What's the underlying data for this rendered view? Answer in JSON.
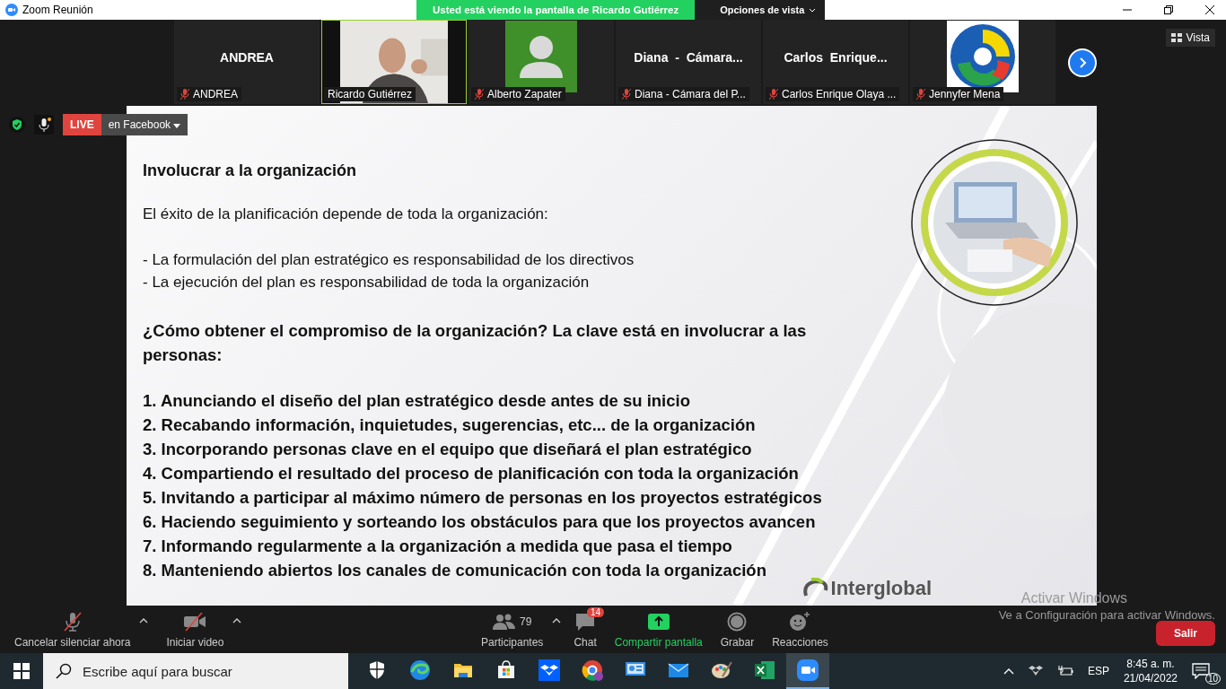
{
  "window": {
    "title": "Zoom Reunión"
  },
  "share_banner": {
    "text": "Usted está viendo la pantalla de Ricardo Gutiérrez",
    "view_options": "Opciones de vista"
  },
  "view_button": "Vista",
  "participants": [
    {
      "kind": "name",
      "display": "ANDREA",
      "name": "ANDREA",
      "muted": true,
      "speaking": false
    },
    {
      "kind": "video",
      "name": "Ricardo Gutiérrez",
      "muted": false,
      "speaking": true
    },
    {
      "kind": "avatar",
      "name": "Alberto Zapater",
      "muted": true,
      "speaking": false
    },
    {
      "kind": "name",
      "display": "Diana  -  Cámara...",
      "name": "Diana - Cámara del P...",
      "muted": true,
      "speaking": false
    },
    {
      "kind": "name",
      "display": "Carlos  Enrique...",
      "name": "Carlos Enrique Olaya ...",
      "muted": true,
      "speaking": false
    },
    {
      "kind": "logo",
      "name": "Jennyfer Mena",
      "muted": true,
      "speaking": false
    }
  ],
  "live": {
    "label": "LIVE",
    "platform": "en Facebook"
  },
  "slide": {
    "title": "Involucrar a la organización",
    "intro": "El éxito de la planificación depende de toda la organización:",
    "bullets": [
      "- La formulación del plan estratégico es responsabilidad de los directivos",
      "- La ejecución del plan es responsabilidad de toda la organización"
    ],
    "question": "¿Cómo obtener el compromiso de la organización? La clave está en involucrar a las personas:",
    "steps": [
      "1.  Anunciando el diseño del plan estratégico desde antes de su inicio",
      "2. Recabando información, inquietudes, sugerencias, etc... de la organización",
      "3. Incorporando personas clave en el equipo que diseñará el plan estratégico",
      "4. Compartiendo el resultado del proceso de planificación con toda la organización",
      "5. Invitando a participar al máximo número de personas en los proyectos estratégicos",
      "6. Haciendo seguimiento y sorteando los obstáculos para que los proyectos avancen",
      "7. Informando regularmente a la organización a medida que pasa el tiempo",
      "8. Manteniendo abiertos los canales de comunicación con toda la organización"
    ],
    "logo": "Interglobal"
  },
  "toolbar": [
    {
      "kind": "mic",
      "label": "Cancelar silenciar ahora",
      "caret": true
    },
    {
      "kind": "camera",
      "label": "Iniciar video",
      "caret": true
    },
    {
      "kind": "participants",
      "label": "Participantes",
      "count": "79",
      "caret": true
    },
    {
      "kind": "chat",
      "label": "Chat",
      "badge": "14",
      "caret": false
    },
    {
      "kind": "share",
      "label": "Compartir pantalla",
      "caret": false
    },
    {
      "kind": "record",
      "label": "Grabar",
      "caret": false
    },
    {
      "kind": "reactions",
      "label": "Reacciones",
      "caret": false
    }
  ],
  "leave_button": "Salir",
  "activation": {
    "title": "Activar Windows",
    "text": "Ve a Configuración para activar Windows."
  },
  "taskbar": {
    "search_placeholder": "Escribe aquí para buscar",
    "apps": [
      {
        "kind": "shield",
        "active": false
      },
      {
        "kind": "edge",
        "active": false
      },
      {
        "kind": "folder",
        "active": false
      },
      {
        "kind": "store",
        "active": false
      },
      {
        "kind": "dropbox",
        "active": false
      },
      {
        "kind": "chrome",
        "active": false
      },
      {
        "kind": "monitor",
        "active": false
      },
      {
        "kind": "mail",
        "active": false
      },
      {
        "kind": "paint",
        "active": false
      },
      {
        "kind": "excel",
        "active": false
      },
      {
        "kind": "zoom",
        "active": true
      }
    ],
    "language": "ESP",
    "time": "8:45 a. m.",
    "date": "21/04/2022",
    "notifications": "10"
  }
}
